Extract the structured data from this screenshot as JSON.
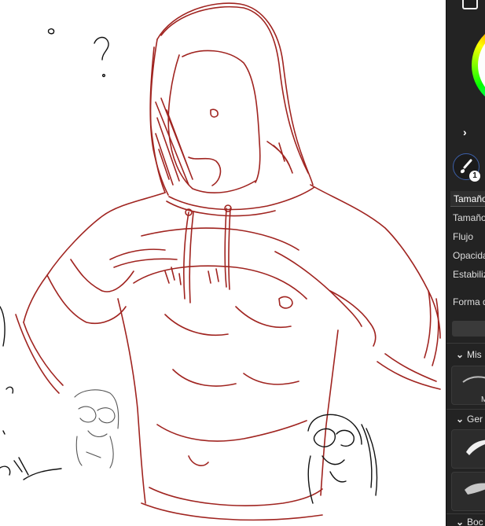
{
  "canvas": {
    "stroke_color": "#a02420",
    "sketch_gray": "#555555",
    "ink_black": "#111111",
    "question_mark": "?"
  },
  "panel": {
    "brush_badge": "1",
    "properties_tab": "Tamaño",
    "properties": [
      "Tamaño",
      "Flujo",
      "Opacidad",
      "Estabiliz"
    ],
    "shape_label": "Forma d",
    "sections": [
      {
        "label": "Mis"
      },
      {
        "label": "Ger"
      },
      {
        "label": "Boc"
      }
    ],
    "tile_caption": "M",
    "colors": {
      "panel_bg": "#232323",
      "accent_blue": "#3c5fa8"
    }
  }
}
